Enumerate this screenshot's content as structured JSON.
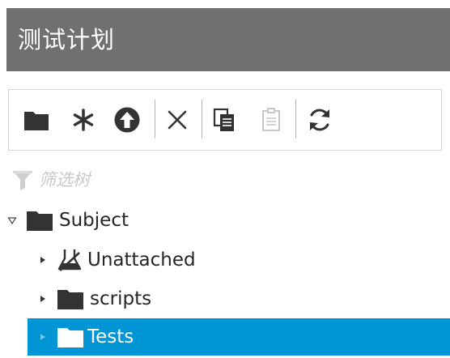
{
  "header": {
    "title": "测试计划"
  },
  "toolbar": {
    "buttons": [
      {
        "icon": "new-folder-icon",
        "enabled": true
      },
      {
        "icon": "asterisk-icon",
        "enabled": true
      },
      {
        "icon": "upload-icon",
        "enabled": true
      },
      {
        "icon": "delete-icon",
        "enabled": true
      },
      {
        "icon": "copy-icon",
        "enabled": true
      },
      {
        "icon": "paste-icon",
        "enabled": false
      },
      {
        "icon": "refresh-icon",
        "enabled": true
      }
    ]
  },
  "filter": {
    "label": "筛选树",
    "icon": "funnel-icon"
  },
  "tree": {
    "root": {
      "label": "Subject",
      "expanded": true,
      "icon": "folder-icon"
    },
    "children": [
      {
        "label": "Unattached",
        "icon": "unattached-icon",
        "expanded": false
      },
      {
        "label": "scripts",
        "icon": "folder-icon",
        "expanded": false
      },
      {
        "label": "Tests",
        "icon": "folder-icon",
        "expanded": false,
        "selected": true
      }
    ]
  },
  "colors": {
    "header_bg": "#6f706f",
    "selected_bg": "#0096d6",
    "icon_dark": "#333333",
    "disabled": "#c8c8c8"
  }
}
